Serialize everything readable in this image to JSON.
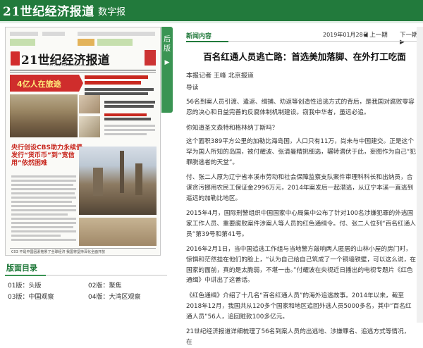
{
  "header": {
    "brand": "21世纪经济报道",
    "section": "数字报"
  },
  "paper_preview": {
    "masthead": "21世纪经济报道",
    "masthead_en": "21ST CENTURY BUSINESS HERALD",
    "banner": "4亿人在旅途",
    "headline_left": "央行创设CBS助力永续债发行“货币币”到“宽信用”依然困难",
    "footer_line": "C03 不是中国因素拖累了全球经济  我国将坚持深化全面开放"
  },
  "tab": {
    "label": "后版",
    "arrow": "▶"
  },
  "directory": {
    "title": "版面目录",
    "items": [
      {
        "label": "01版：头版"
      },
      {
        "label": "02版：聚焦"
      },
      {
        "label": "03版：中国观察"
      },
      {
        "label": "04版：大湾区观察"
      }
    ]
  },
  "article": {
    "section_label": "新闻内容",
    "date": "2019年01月28日",
    "prev": "上一期",
    "next": "下一期",
    "title": "百名红通人员逃亡路：首选美加落脚、在外打工吃面",
    "byline": "本报记者 王峰 北京报道",
    "paragraphs": [
      "导读",
      "56名到案人员引渡、遣返、缉捕、劝返等创造性追逃方式的背后，是我国对腐败零容忍的决心和日益完善的反腐体制机制建设。窃我中华者，虽远必追。",
      "你知道圣文森特和格林纳丁斯吗？",
      "这个面积389平方公里的加勒比海岛国，人口只有11万，尚未与中国建交。正是这个罕为国人所知的岛国，被付耀波、张清曼精挑细选，辗转潜伏于此，妄图作为自己“犯罪脱逃者的天堂”。",
      "付、张二人原为辽宁省本溪市劳动和社会保障监察支队案件审理科科长和出纳员，合谋贪污挪用农民工保证金2996万元，2014年案发后一起潜逃，从辽宁本溪一直逃到遥远的加勒比地区。",
      "2015年4月，国际刑警组织中国国家中心局集中公布了针对100名涉嫌犯罪的外逃国家工作人员、重要腐败案件涉案人等人员的红色通缉令。付、张二人位列“百名红通人员”第39号和第41号。",
      "2016年2月1日，当中国追逃工作组与当地警方敲响两人匿居的山林小屋的房门时，惊惧和茫然挂在他们的脸上，“认为自己给自己筑成了一个铜墙铁壁，可以这么说，在国家的面前，真的是太脆弱，不堪一击。”付耀波在央视近日播出的电视专题片《红色通缉》中讲出了这番话。",
      "《红色通缉》介绍了十几名“百名红通人员”的海外追逃故事。2014年以来，截至2018年12月，我国共从120多个国家和地区追回外逃人员5000多名，其中“百名红通人员”56人，追回赃款100多亿元。",
      "21世纪经济报道详细梳理了56名到案人员的出逃地、涉嫌罪名、追逃方式等情况，在"
    ]
  }
}
